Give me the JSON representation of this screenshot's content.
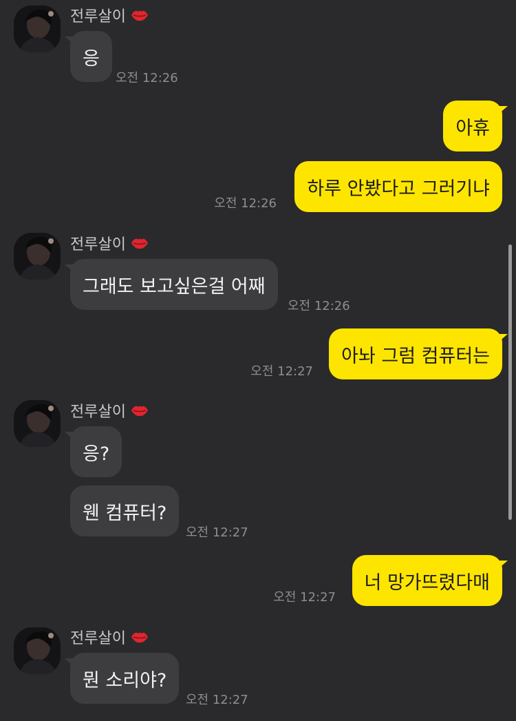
{
  "contact": {
    "name": "전루살이"
  },
  "groups": [
    {
      "messages": [
        "응"
      ],
      "time": "오전 12:26"
    },
    {
      "messages": [
        "아휴",
        "하루 안봤다고 그러기냐"
      ],
      "time": "오전 12:26"
    },
    {
      "messages": [
        "그래도 보고싶은걸 어째"
      ],
      "time": "오전 12:26"
    },
    {
      "messages": [
        "아놔 그럼 컴퓨터는"
      ],
      "time": "오전 12:27"
    },
    {
      "messages": [
        "응?",
        "웬 컴퓨터?"
      ],
      "time": "오전 12:27"
    },
    {
      "messages": [
        "너 망가뜨렸다매"
      ],
      "time": "오전 12:27"
    },
    {
      "messages": [
        "뭔 소리야?"
      ],
      "time": "오전 12:27"
    }
  ],
  "colors": {
    "background": "#2a2a2c",
    "incoming_bubble": "#3d3d3f",
    "outgoing_bubble": "#fee500",
    "timestamp": "#8e8e8e"
  },
  "icons": {
    "name_decoration": "kiss-lips-icon",
    "avatar": "profile-photo"
  }
}
